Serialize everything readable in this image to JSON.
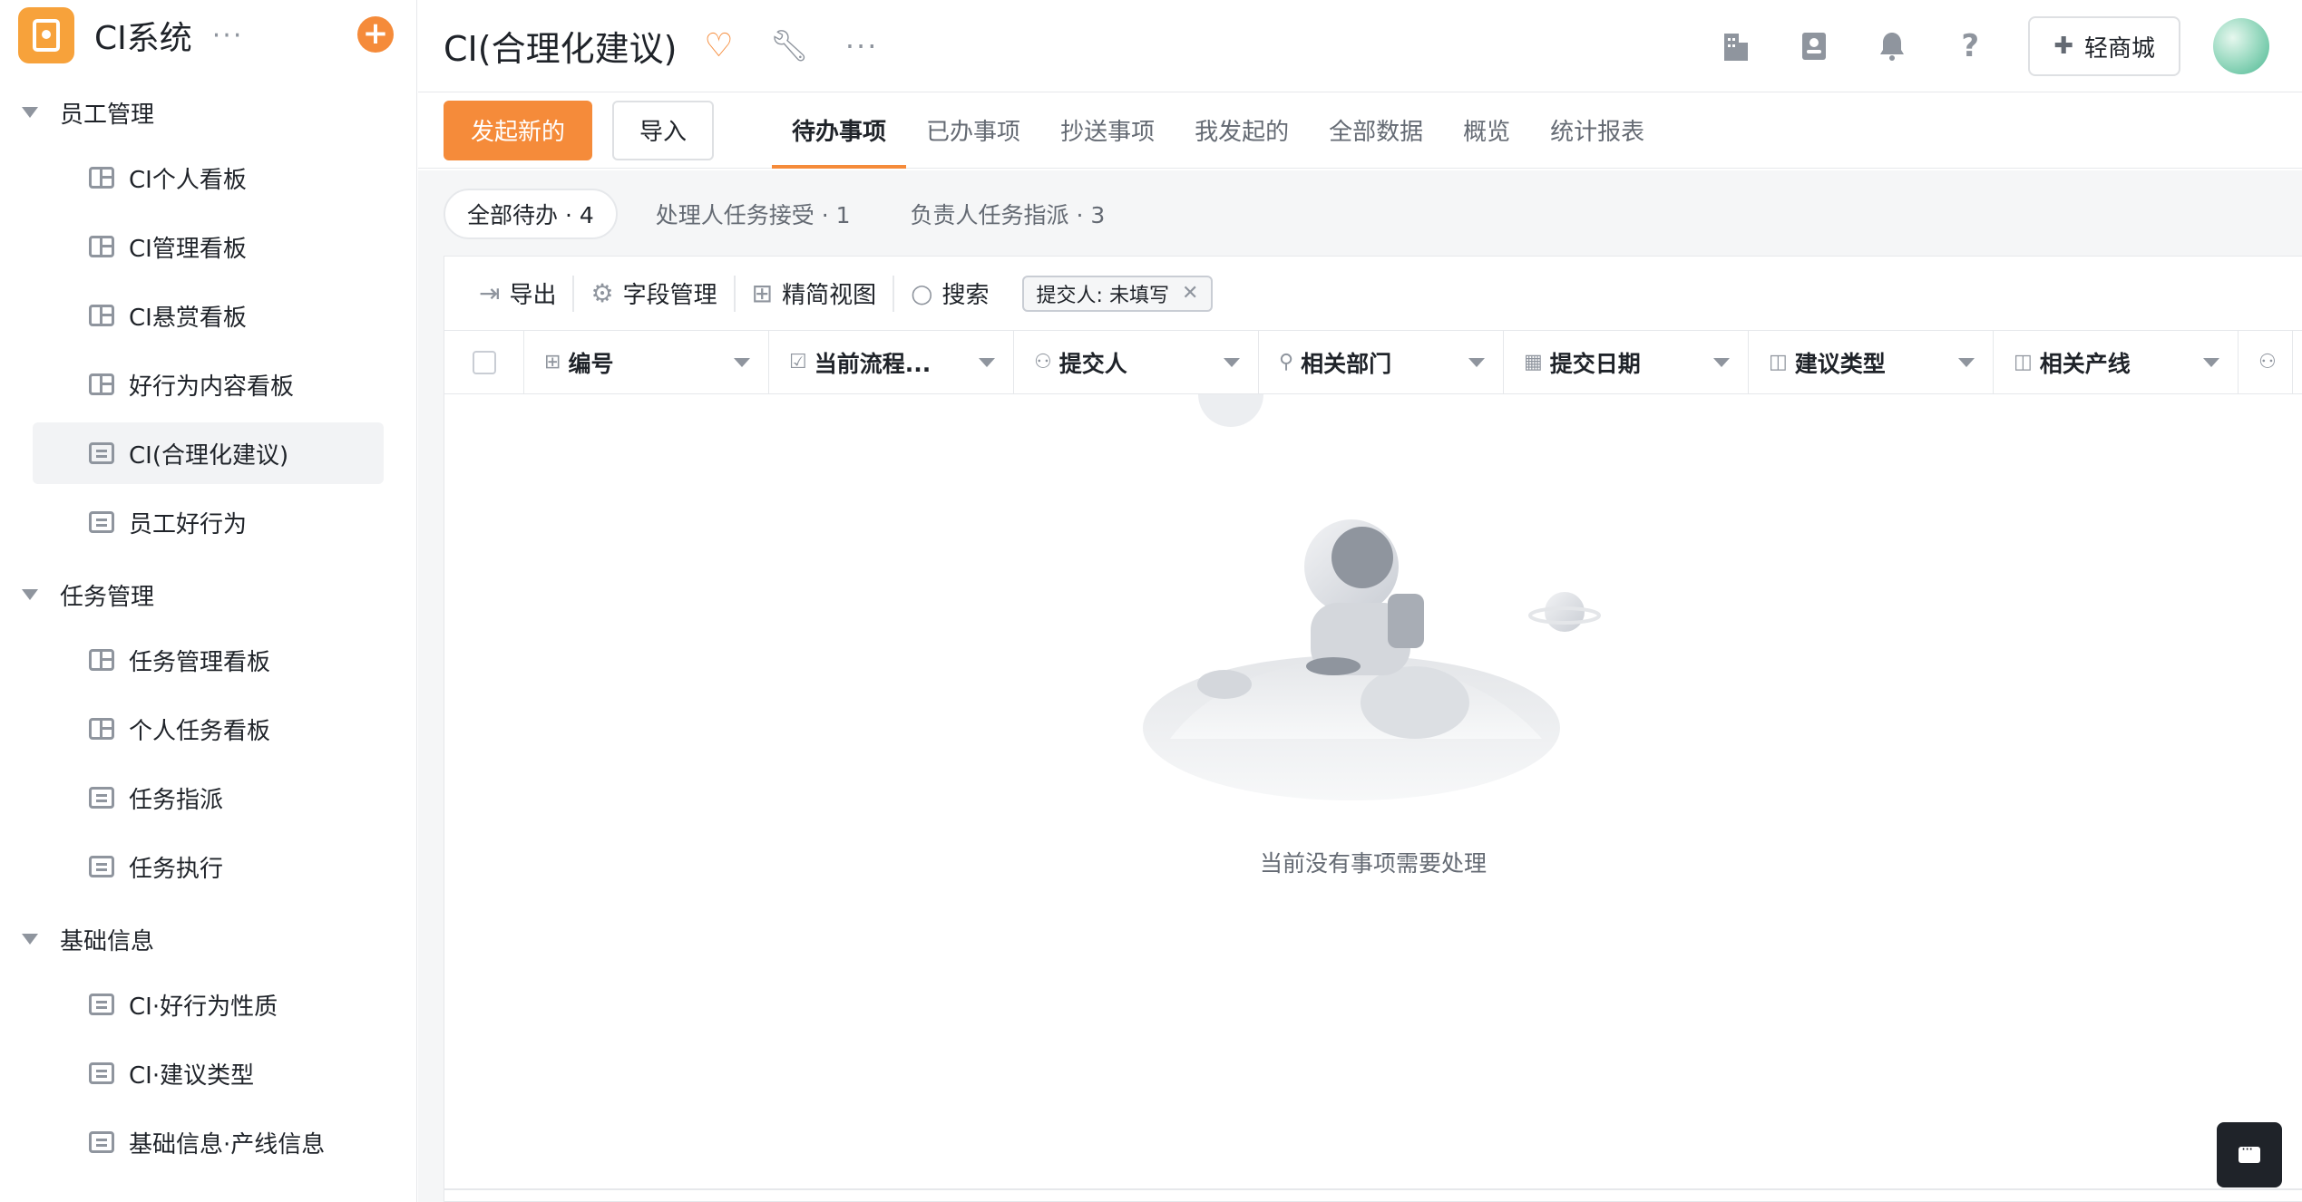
{
  "app": {
    "title": "CI系统",
    "more": "···",
    "add": "+"
  },
  "sidebar": {
    "groups": [
      {
        "title": "员工管理",
        "items": [
          {
            "label": "CI个人看板",
            "icon": "board-icon"
          },
          {
            "label": "CI管理看板",
            "icon": "board-icon"
          },
          {
            "label": "CI悬赏看板",
            "icon": "board-icon"
          },
          {
            "label": "好行为内容看板",
            "icon": "board-icon"
          },
          {
            "label": "CI(合理化建议)",
            "icon": "form-icon",
            "active": true
          },
          {
            "label": "员工好行为",
            "icon": "form-icon"
          }
        ]
      },
      {
        "title": "任务管理",
        "items": [
          {
            "label": "任务管理看板",
            "icon": "board-icon"
          },
          {
            "label": "个人任务看板",
            "icon": "board-icon"
          },
          {
            "label": "任务指派",
            "icon": "form-icon"
          },
          {
            "label": "任务执行",
            "icon": "form-icon"
          }
        ]
      },
      {
        "title": "基础信息",
        "items": [
          {
            "label": "CI·好行为性质",
            "icon": "form-icon"
          },
          {
            "label": "CI·建议类型",
            "icon": "form-icon"
          },
          {
            "label": "基础信息·产线信息",
            "icon": "form-icon"
          }
        ]
      }
    ]
  },
  "header": {
    "title": "CI(合理化建议)",
    "shop_label": "轻商城",
    "icons": [
      "building-icon",
      "contacts-icon",
      "bell-icon",
      "help-icon"
    ]
  },
  "toolbar": {
    "new_label": "发起新的",
    "import_label": "导入",
    "tabs": [
      "待办事项",
      "已办事项",
      "抄送事项",
      "我发起的",
      "全部数据",
      "概览",
      "统计报表"
    ],
    "active_tab": 0
  },
  "filters": {
    "chips": [
      "全部待办 · 4",
      "处理人任务接受 · 1",
      "负责人任务指派 · 3"
    ]
  },
  "grid": {
    "tools": {
      "export": "导出",
      "fields": "字段管理",
      "view": "精简视图",
      "search": "搜索"
    },
    "filter_tag": "提交人: 未填写",
    "columns": [
      {
        "label": "编号",
        "icon": "number-icon"
      },
      {
        "label": "当前流程...",
        "icon": "checkbox-icon"
      },
      {
        "label": "提交人",
        "icon": "user-icon"
      },
      {
        "label": "相关部门",
        "icon": "org-icon"
      },
      {
        "label": "提交日期",
        "icon": "calendar-icon"
      },
      {
        "label": "建议类型",
        "icon": "relation-icon"
      },
      {
        "label": "相关产线",
        "icon": "relation-icon"
      }
    ],
    "empty_text": "当前没有事项需要处理"
  },
  "colors": {
    "accent": "#f58b3a",
    "text": "#1f2329",
    "muted": "#8f959e"
  }
}
